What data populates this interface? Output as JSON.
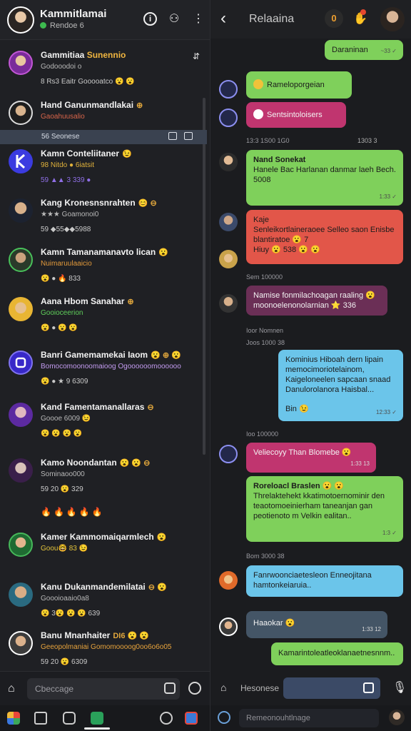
{
  "left_header": {
    "title": "Kammitlamai",
    "status": "Rendoe 6"
  },
  "active_bar": {
    "label": "56 Seonese"
  },
  "chats": [
    {
      "name": "Gammitiaa",
      "accent": "Sunennio",
      "badge": "",
      "preview": "Godooodoi o",
      "meta": "8 Rs3 Eaitr Gooooatco 😮 😮",
      "corner": "⇵"
    },
    {
      "name": "Hand Ganunmandlakai",
      "accent": "",
      "badge": "⊕",
      "preview": "Gaoahuusalio",
      "meta": ""
    },
    {
      "name": "Kamn Conteliitaner",
      "accent": "",
      "badge": "😉",
      "preview": "98 Nitdo ● 6iatsit",
      "meta": "59 ▲▲ 3 339 ●"
    },
    {
      "name": "Kang Kronesnsnrahten",
      "accent": "",
      "badge": "😊 ⊖",
      "preview": "★★★ Goamonoi0",
      "meta": "59 ◆55◆◆5988"
    },
    {
      "name": "Kamn Tamanamanavto lican",
      "accent": "",
      "badge": "😮",
      "preview": "Nuimaruulaaicio",
      "meta": "😮 ● 🔥 833"
    },
    {
      "name": "Aana Hbom Sanahar",
      "accent": "",
      "badge": "⊕",
      "preview": "Gooioceerion",
      "meta": "😮 ● 😮 😮"
    },
    {
      "name": "Banri Gamemamekai Iaom",
      "accent": "",
      "badge": "😮 ⊕ 😮",
      "preview": "Bomocomoonoomaioog Ogoooooomoooooo",
      "meta": "😮 ● ★ 9 6309"
    },
    {
      "name": "Kand Famentamanallaras",
      "accent": "",
      "badge": "⊖",
      "preview": "Goooe 6009 😉",
      "meta": "😮 😮 😮 😮"
    },
    {
      "name": "Kamo Noondantan",
      "accent": "",
      "badge": "😮 😮 ⊖",
      "preview": "Sominaoo000",
      "meta": "59 20 😮 329"
    },
    {
      "name": "Kamer Kammomaiqarmlech",
      "accent": "",
      "badge": "😮",
      "preview": "Goou🤓 83 😉",
      "meta": ""
    },
    {
      "name": "Kanu Dukanmandemilatai",
      "accent": "",
      "badge": "⊖ 😮",
      "preview": "Goooioaaio0a8",
      "meta": "😮 3😮 😮 😮 639"
    },
    {
      "name": "Banu Mnanhaiter",
      "accent": "",
      "badge": "DI6 😮 😮",
      "preview": "Geeopolmaniai Gomomoooog0oo6o6o05",
      "meta": "59 20 😮 6309"
    }
  ],
  "reaction_row": "🔥🔥🔥🔥🔥",
  "left_compose": {
    "placeholder": "Cbeccage"
  },
  "right_header": {
    "title": "Relaaina",
    "badge": "0"
  },
  "messages": [
    {
      "text": "Daraninan",
      "time": "~33 ✓"
    },
    {
      "text": "Rameloporgeian"
    },
    {
      "text": "Sentsintoloisers"
    },
    {
      "text": "Nand Sonekat",
      "body": "Hanele Bac Harlanan danmar laeh Bech.",
      "extra": "5008",
      "time": "1:33 ✓"
    },
    {
      "text": "Kaje",
      "body": "Senleikortlaineraoee Selleo saon Enisbe blantiratoe 😮 7",
      "extra": "Hiuy 😮 538 😮 😮"
    },
    {
      "text": "Namise fonmilachoagan raaling 😮",
      "body": "moonoelenonolarnian ⭐ 336"
    },
    {
      "text": "Kominius Hiboah dern lipain",
      "body": "memocimoriotelainom, Kaigeloneelen sapcaan snaad Danulorolanora Haisbal...",
      "extra": "Bin 😉",
      "time": "12:33 ✓"
    },
    {
      "text": "Veliecoyy Than Blomebe 😮",
      "time": "1:33 13"
    },
    {
      "text": "Roreloacl Braslen 😮 😮",
      "body": "Threlaktehekt kkatimotoernominir den teaotomoeinierham taneanjan gan peotienoto m Velkin ealitan..",
      "time": "1:3 ✓"
    },
    {
      "text": "Fanrwoonciaetesleon Enneojitana",
      "body": "hamtonkeiaruia.."
    },
    {
      "text": "Haaokar 😮",
      "time": "1:33 12"
    },
    {
      "text": "Kamarintoleatleoklanaetnesnnm.."
    }
  ],
  "system_labels": {
    "s1": "13:3 1S00 1G0",
    "s2": "Ioor Nomnen",
    "s3": "Joos 1000 38",
    "s4": "Bom 3000 38",
    "s5": "Sem 100000",
    "time1": "1303 3",
    "time2": "Ioo 100000"
  },
  "right_compose": {
    "label": "Hesonese"
  },
  "right_bottom": {
    "placeholder": "Remeonouhtlnage"
  }
}
